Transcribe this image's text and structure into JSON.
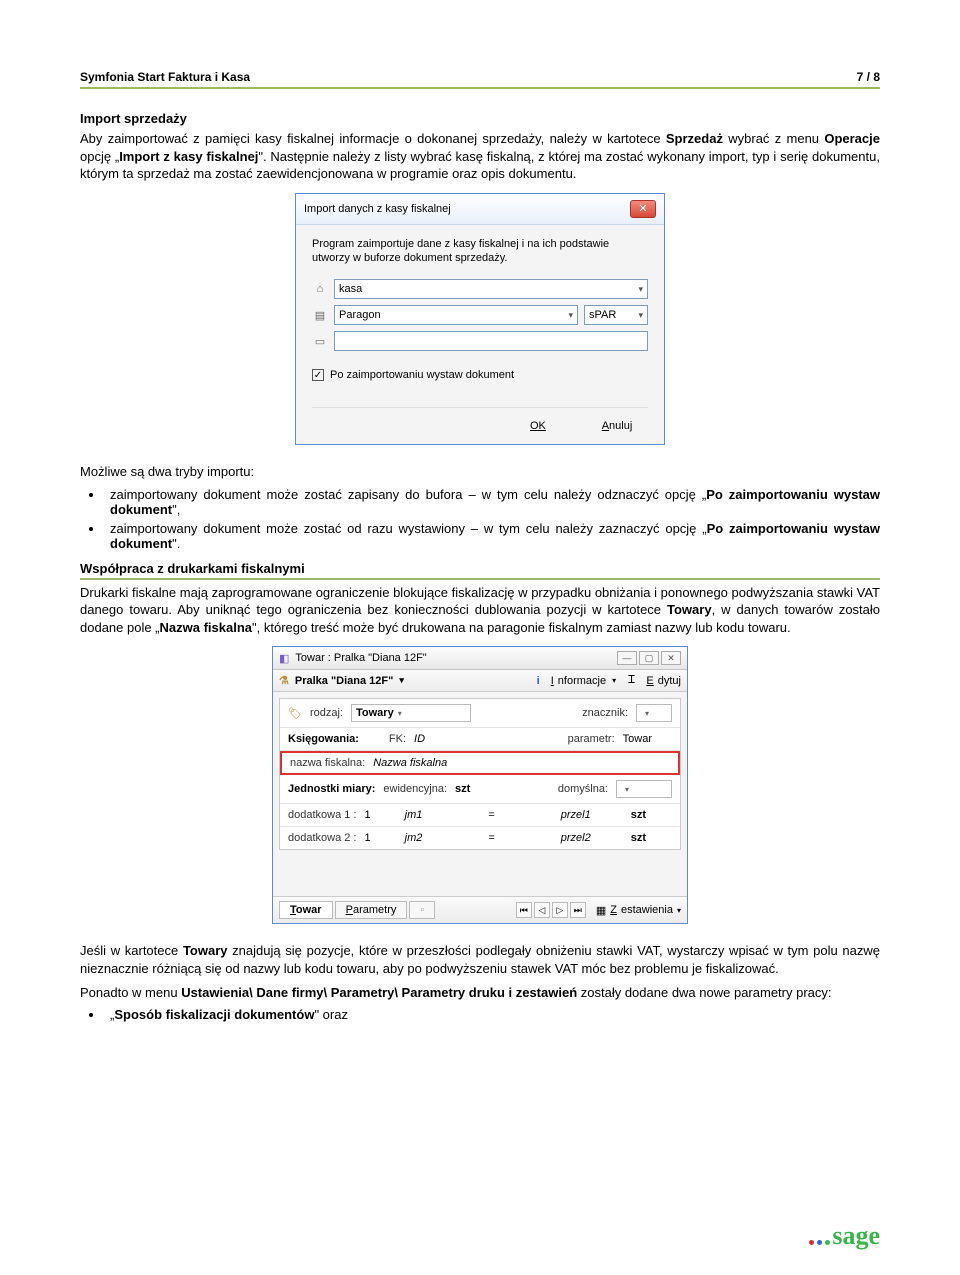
{
  "header": {
    "title": "Symfonia Start Faktura i Kasa",
    "page": "7 / 8"
  },
  "s1": {
    "title": "Import sprzedaży",
    "p1a": "Aby zaimportować z pamięci kasy fiskalnej informacje o dokonanej sprzedaży, należy w kartotece ",
    "p1b": "Sprzedaż",
    "p1c": " wybrać z menu ",
    "p1d": "Operacje",
    "p1e": " opcję „",
    "p1f": "Import z kasy fiskalnej",
    "p1g": "\". Następnie należy z listy wybrać kasę fiskalną, z której ma zostać wykonany import, typ i serię dokumentu, którym ta sprzedaż ma zostać zaewidencjonowana w programie oraz opis dokumentu."
  },
  "dlg1": {
    "title": "Import danych z kasy fiskalnej",
    "info": "Program zaimportuje dane z kasy fiskalnej i na ich podstawie utworzy w buforze dokument sprzedaży.",
    "kasa": "kasa",
    "doc_type": "Paragon",
    "doc_series": "sPAR",
    "desc": "",
    "check_label": "Po zaimportowaniu wystaw dokument",
    "ok": "OK",
    "cancel_pre": "A",
    "cancel_suf": "nuluj"
  },
  "modes": {
    "intro": "Możliwe są dwa tryby importu:",
    "b1a": "zaimportowany dokument może zostać zapisany do bufora – w tym celu należy odznaczyć opcję „",
    "b1b": "Po zaimportowaniu wystaw dokument",
    "b1c": "\",",
    "b2a": "zaimportowany dokument może zostać od razu wystawiony – w tym celu należy zaznaczyć opcję „",
    "b2b": "Po zaimportowaniu wystaw dokument",
    "b2c": "\"."
  },
  "s2": {
    "title": "Współpraca z drukarkami fiskalnymi",
    "p1a": "Drukarki fiskalne mają zaprogramowane ograniczenie blokujące fiskalizację w przypadku obniżania i ponownego podwyższania stawki VAT danego towaru. Aby uniknąć tego ograniczenia bez konieczności dublowania pozycji w kartotece ",
    "p1b": "Towary",
    "p1c": ", w danych towarów zostało dodane pole „",
    "p1d": "Nazwa fiskalna",
    "p1e": "\", którego treść może być drukowana na paragonie fiskalnym zamiast nazwy lub kodu towaru."
  },
  "dlg2": {
    "win_title": "Towar : Pralka \"Diana 12F\"",
    "name": "Pralka \"Diana 12F\"",
    "info_pre": "I",
    "info_suf": "nformacje",
    "edit_pre": "E",
    "edit_suf": "dytuj",
    "rodzaj_lab": "rodzaj:",
    "rodzaj_val": "Towary",
    "znacznik_lab": "znacznik:",
    "ks_lab": "Księgowania:",
    "fk_lab": "FK:",
    "fk_val": "ID",
    "param_lab": "parametr:",
    "param_val": "Towar",
    "fisk_lab": "nazwa fiskalna:",
    "fisk_val": "Nazwa fiskalna",
    "units_head": "Jednostki miary:",
    "ewid_lab": "ewidencyjna:",
    "ewid_val": "szt",
    "dom_lab": "domyślna:",
    "d1_lab": "dodatkowa 1  :",
    "d1_q": "1",
    "d1_u": "jm1",
    "d1_eq": "=",
    "d1_p": "przel1",
    "d1_s": "szt",
    "d2_lab": "dodatkowa 2  :",
    "d2_q": "1",
    "d2_u": "jm2",
    "d2_eq": "=",
    "d2_p": "przel2",
    "d2_s": "szt",
    "tab1_pre": "T",
    "tab1_suf": "owar",
    "tab2_pre": "P",
    "tab2_suf": "arametry",
    "zest_pre": "Z",
    "zest_suf": "estawienia"
  },
  "s3": {
    "p1a": "Jeśli w kartotece ",
    "p1b": "Towary",
    "p1c": " znajdują się pozycje, które w przeszłości podlegały obniżeniu stawki VAT, wystarczy wpisać w tym polu nazwę nieznacznie różniącą się od nazwy lub kodu towaru, aby po podwyższeniu stawek VAT móc bez problemu je fiskalizować.",
    "p2a": "Ponadto w menu ",
    "p2b": "Ustawienia\\ Dane firmy\\ Parametry\\ Parametry druku i zestawień",
    "p2c": " zostały dodane dwa nowe parametry pracy:",
    "bul1a": "„",
    "bul1b": "Sposób fiskalizacji dokumentów",
    "bul1c": "\" oraz"
  },
  "logo": "sage"
}
